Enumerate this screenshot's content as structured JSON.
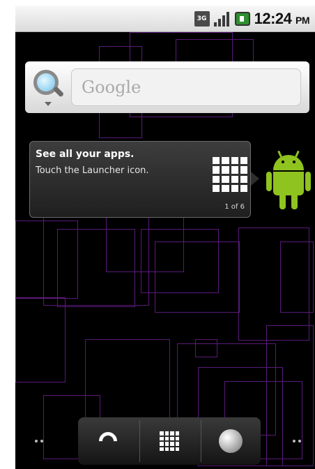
{
  "status_bar": {
    "network_label": "3G",
    "time": "12:24",
    "ampm": "PM",
    "icons": [
      "3g-icon",
      "signal-icon",
      "battery-icon"
    ]
  },
  "search_widget": {
    "placeholder": "Google",
    "icon": "search-icon"
  },
  "tooltip": {
    "title": "See all your apps.",
    "body": "Touch the Launcher icon.",
    "page_indicator": "1 of 6",
    "icon": "app-grid-icon"
  },
  "dock": {
    "items": [
      "phone-icon",
      "launcher-grid-icon",
      "browser-globe-icon"
    ]
  },
  "colors": {
    "wallpaper": "#000000",
    "wallpaper_lines": "#5a1a7a",
    "android_green": "#8fc31f"
  }
}
